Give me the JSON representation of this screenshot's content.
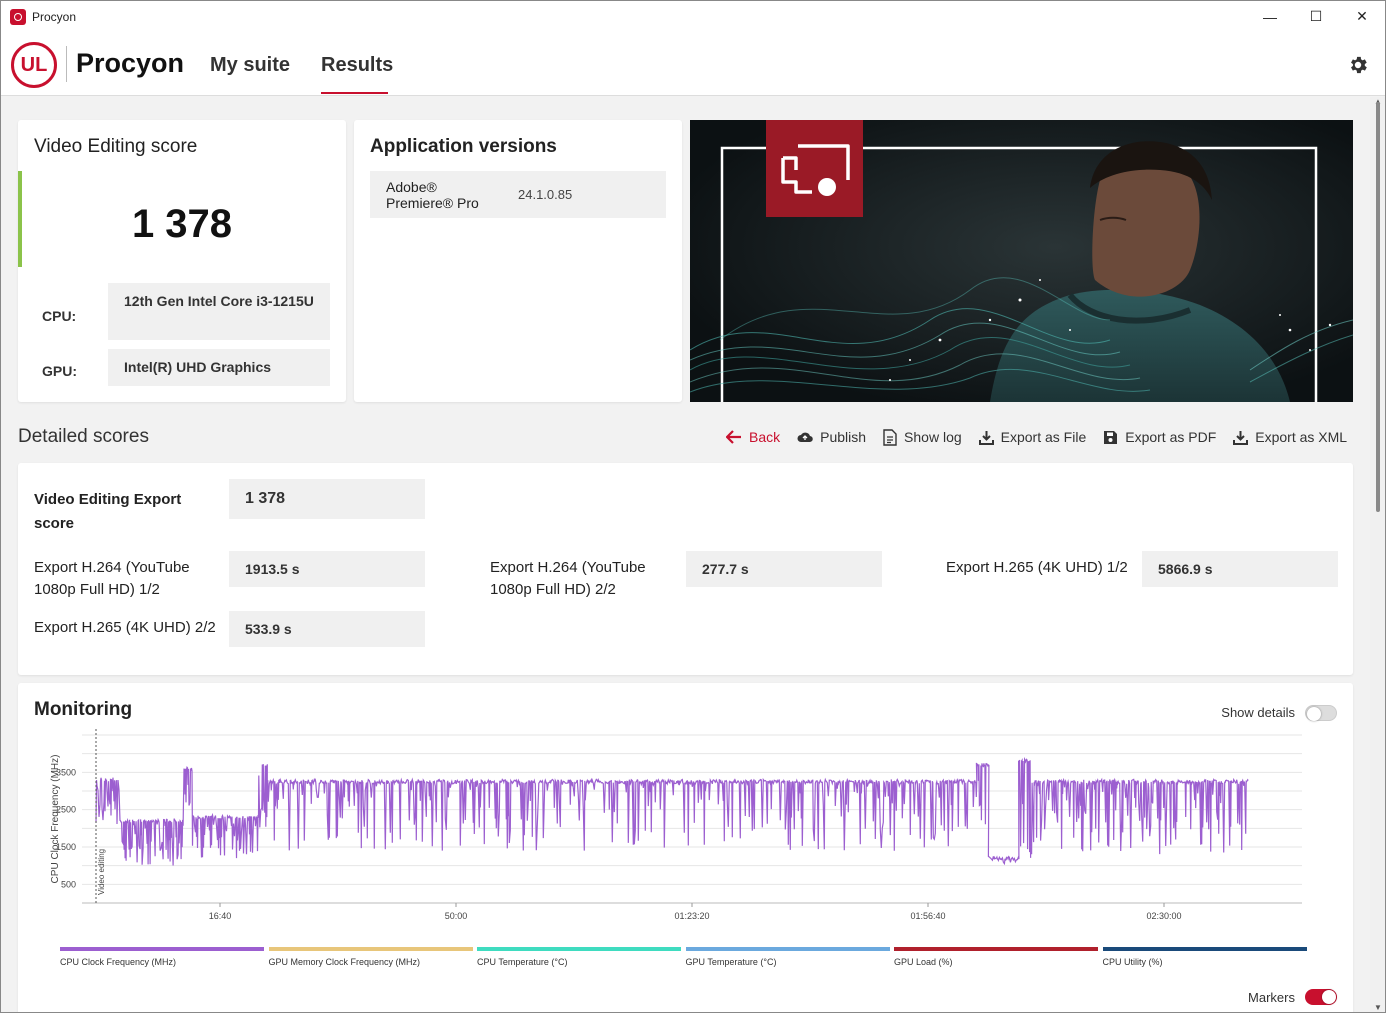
{
  "window": {
    "title": "Procyon",
    "minimize": "—",
    "maximize": "☐",
    "close": "✕"
  },
  "header": {
    "logo": "UL",
    "brand": "Procyon",
    "nav": [
      "My suite",
      "Results"
    ],
    "active_nav": "Results"
  },
  "score_card": {
    "title": "Video Editing score",
    "score": "1 378",
    "cpu_label": "CPU:",
    "cpu_value": "12th Gen Intel Core i3-1215U",
    "gpu_label": "GPU:",
    "gpu_value": "Intel(R) UHD Graphics",
    "accent": "#8bc34a"
  },
  "app_versions": {
    "title": "Application versions",
    "apps": [
      {
        "name": "Adobe® Premiere® Pro",
        "version": "24.1.0.85"
      }
    ]
  },
  "detailed": {
    "title": "Detailed scores",
    "toolbar": {
      "back": "Back",
      "publish": "Publish",
      "show_log": "Show log",
      "export_file": "Export as File",
      "export_pdf": "Export as PDF",
      "export_xml": "Export as XML"
    },
    "main": {
      "label": "Video Editing Export score",
      "value": "1 378"
    },
    "items": [
      {
        "label": "Export H.264 (YouTube 1080p Full HD) 1/2",
        "value": "1913.5 s"
      },
      {
        "label": "Export H.264 (YouTube 1080p Full HD) 2/2",
        "value": "277.7 s"
      },
      {
        "label": "Export H.265 (4K UHD) 1/2",
        "value": "5866.9 s"
      },
      {
        "label": "Export H.265 (4K UHD) 2/2",
        "value": "533.9 s"
      }
    ]
  },
  "monitoring": {
    "title": "Monitoring",
    "show_details": "Show details",
    "show_details_on": false,
    "markers": "Markers",
    "markers_on": true,
    "chart_data": {
      "type": "line",
      "ylabel": "CPU Clock Frequency (MHz)",
      "y_ticks": [
        500,
        1500,
        2500,
        3500
      ],
      "ylim": [
        0,
        4500
      ],
      "x_ticks": [
        "16:40",
        "50:00",
        "01:23:20",
        "01:56:40",
        "02:30:00"
      ],
      "marker_label": "Video editing",
      "series": [
        {
          "name": "CPU Clock Frequency (MHz)",
          "color": "#9c5fd0",
          "segments": [
            {
              "t": [
                0.0,
                0.02
              ],
              "base": 3300,
              "low": 2000,
              "density": 0.7
            },
            {
              "t": [
                0.02,
                0.073
              ],
              "base": 2200,
              "low": 1000,
              "density": 0.6
            },
            {
              "t": [
                0.073,
                0.08
              ],
              "base": 3600,
              "low": 1800,
              "density": 0.5
            },
            {
              "t": [
                0.08,
                0.135
              ],
              "base": 2300,
              "low": 1200,
              "density": 0.7
            },
            {
              "t": [
                0.135,
                0.142
              ],
              "base": 3700,
              "low": 2000,
              "density": 0.5
            },
            {
              "t": [
                0.142,
                0.73
              ],
              "base": 3250,
              "low": 1400,
              "density": 0.3
            },
            {
              "t": [
                0.73,
                0.74
              ],
              "base": 3700,
              "low": 1800,
              "density": 0.5
            },
            {
              "t": [
                0.74,
                0.765
              ],
              "base": 1200,
              "low": 1000,
              "density": 0.2
            },
            {
              "t": [
                0.765,
                0.775
              ],
              "base": 3800,
              "low": 1200,
              "density": 0.5
            },
            {
              "t": [
                0.775,
                0.955
              ],
              "base": 3250,
              "low": 1300,
              "density": 0.5
            }
          ]
        }
      ]
    },
    "legend": [
      {
        "name": "CPU Clock Frequency (MHz)",
        "color": "#9c5fd0"
      },
      {
        "name": "GPU Memory Clock Frequency (MHz)",
        "color": "#e8c67a"
      },
      {
        "name": "CPU Temperature (°C)",
        "color": "#3fdcc0"
      },
      {
        "name": "GPU Temperature (°C)",
        "color": "#6ba9de"
      },
      {
        "name": "GPU Load (%)",
        "color": "#b0202c"
      },
      {
        "name": "CPU Utility (%)",
        "color": "#1a4a7a"
      }
    ]
  }
}
